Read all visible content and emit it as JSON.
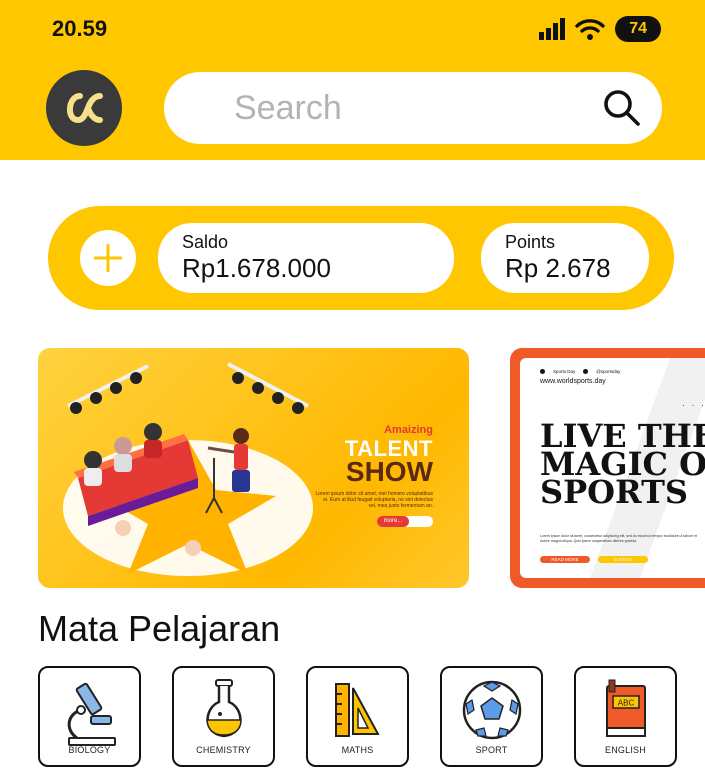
{
  "status_bar": {
    "time": "20.59",
    "battery": "74",
    "icons": [
      "signal-icon",
      "wifi-icon",
      "battery-icon"
    ]
  },
  "header": {
    "logo_icon": "app-logo",
    "search": {
      "placeholder": "Search",
      "value": ""
    }
  },
  "wallet": {
    "add_icon": "plus-icon",
    "saldo_label": "Saldo",
    "saldo_value": "Rp1.678.000",
    "points_label": "Points",
    "points_value": "Rp 2.678"
  },
  "banners": [
    {
      "kicker": "Amaizing",
      "title_1": "TALENT",
      "title_2": "SHOW",
      "body": "Lorem ipsum dolor sit amet, mei homero voluptatibus ei. Eum at illud feugait voluptaria, no sint delectus vel, mea justo fermentum an.",
      "button": "more..."
    },
    {
      "social_1": "Sports Day",
      "social_2": "@sportsday",
      "url": "www.worldsports.day",
      "headline_1": "LIVE THE",
      "headline_2": "MAGIC OF",
      "headline_3": "SPORTS",
      "body": "Lorem ipsum dolor sit amet, consectetur adipiscing elit, sed do eiusmod tempor incididunt ut labore et dolore magna aliqua. Quis ipsum suspendisse ultrices gravida.",
      "button_1": "READ MORE",
      "button_2": "EVENTS"
    }
  ],
  "section_title": "Mata Pelajaran",
  "subjects": [
    {
      "label": "BIOLOGY",
      "icon": "microscope-icon"
    },
    {
      "label": "CHEMISTRY",
      "icon": "flask-icon"
    },
    {
      "label": "MATHS",
      "icon": "ruler-triangle-icon"
    },
    {
      "label": "SPORT",
      "icon": "soccer-ball-icon"
    },
    {
      "label": "ENGLISH",
      "icon": "book-icon",
      "book_text": "ABC"
    }
  ],
  "colors": {
    "primary": "#FFC700",
    "dark": "#111111",
    "sport_accent": "#F05A28"
  }
}
